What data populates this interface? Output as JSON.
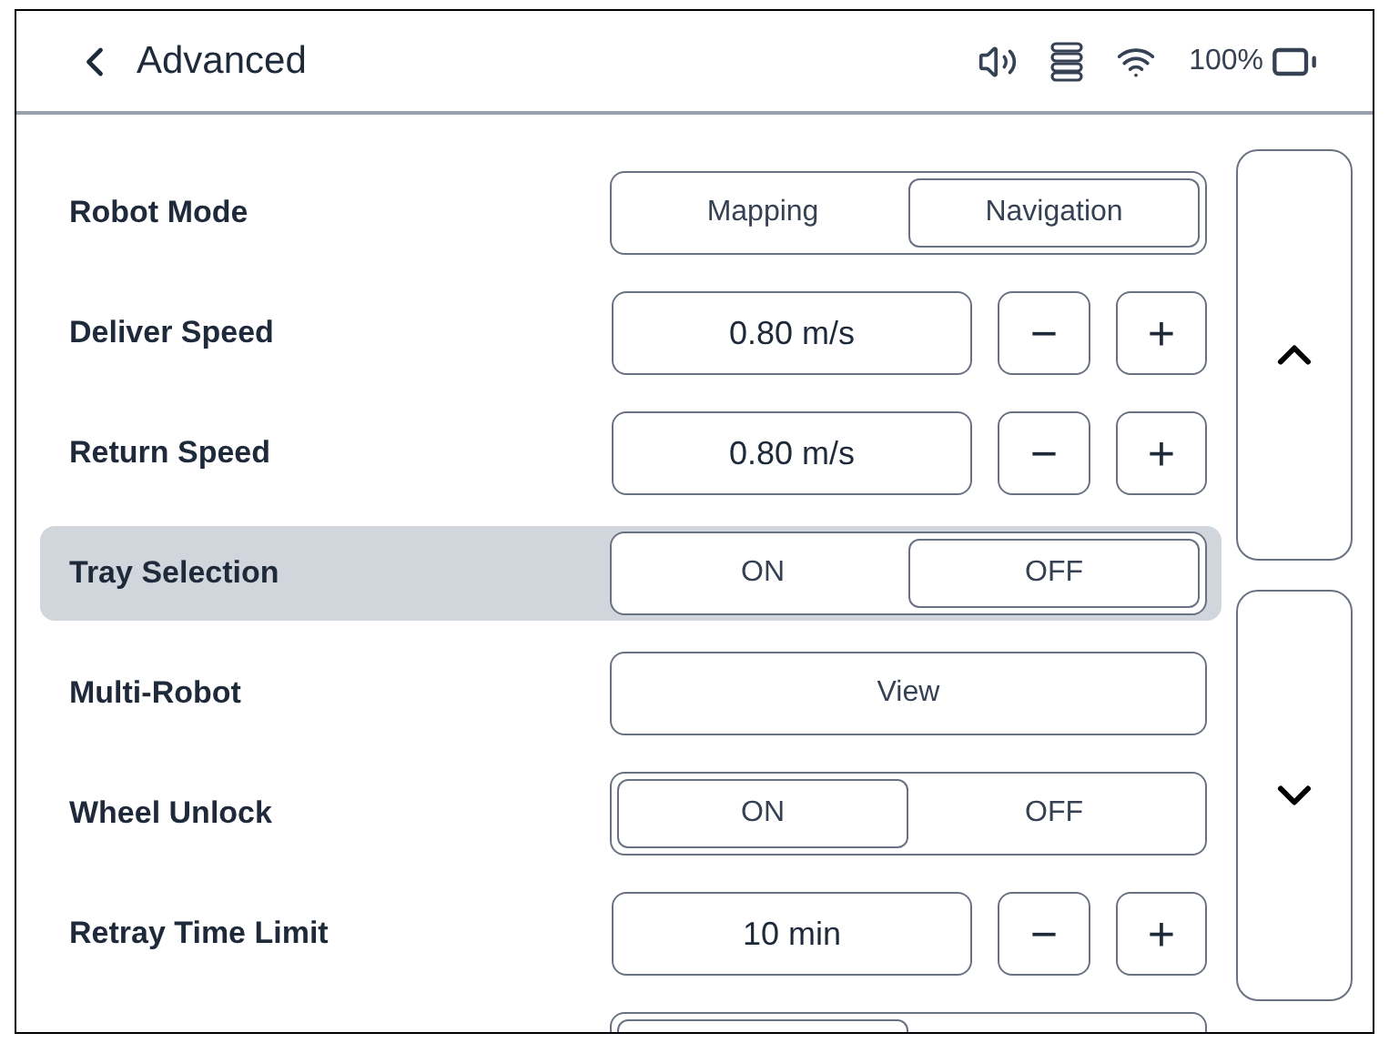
{
  "header": {
    "title": "Advanced",
    "battery_text": "100%"
  },
  "rows": [
    {
      "kind": "segment",
      "label": "Robot Mode",
      "highlighted": false,
      "options": [
        {
          "label": "Mapping",
          "selected": false
        },
        {
          "label": "Navigation",
          "selected": true
        }
      ]
    },
    {
      "kind": "stepper",
      "label": "Deliver Speed",
      "highlighted": false,
      "value": "0.80 m/s",
      "minus": "−",
      "plus": "+"
    },
    {
      "kind": "stepper",
      "label": "Return Speed",
      "highlighted": false,
      "value": "0.80 m/s",
      "minus": "−",
      "plus": "+"
    },
    {
      "kind": "segment",
      "label": "Tray Selection",
      "highlighted": true,
      "options": [
        {
          "label": "ON",
          "selected": false
        },
        {
          "label": "OFF",
          "selected": true
        }
      ]
    },
    {
      "kind": "button",
      "label": "Multi-Robot",
      "highlighted": false,
      "button": "View"
    },
    {
      "kind": "segment",
      "label": "Wheel Unlock",
      "highlighted": false,
      "options": [
        {
          "label": "ON",
          "selected": true
        },
        {
          "label": "OFF",
          "selected": false
        }
      ]
    },
    {
      "kind": "stepper",
      "label": "Retray Time Limit",
      "highlighted": false,
      "value": "10 min",
      "minus": "−",
      "plus": "+"
    },
    {
      "kind": "segment",
      "highlighted": false,
      "options": [
        {
          "selected": true
        },
        {
          "selected": false
        }
      ]
    }
  ]
}
